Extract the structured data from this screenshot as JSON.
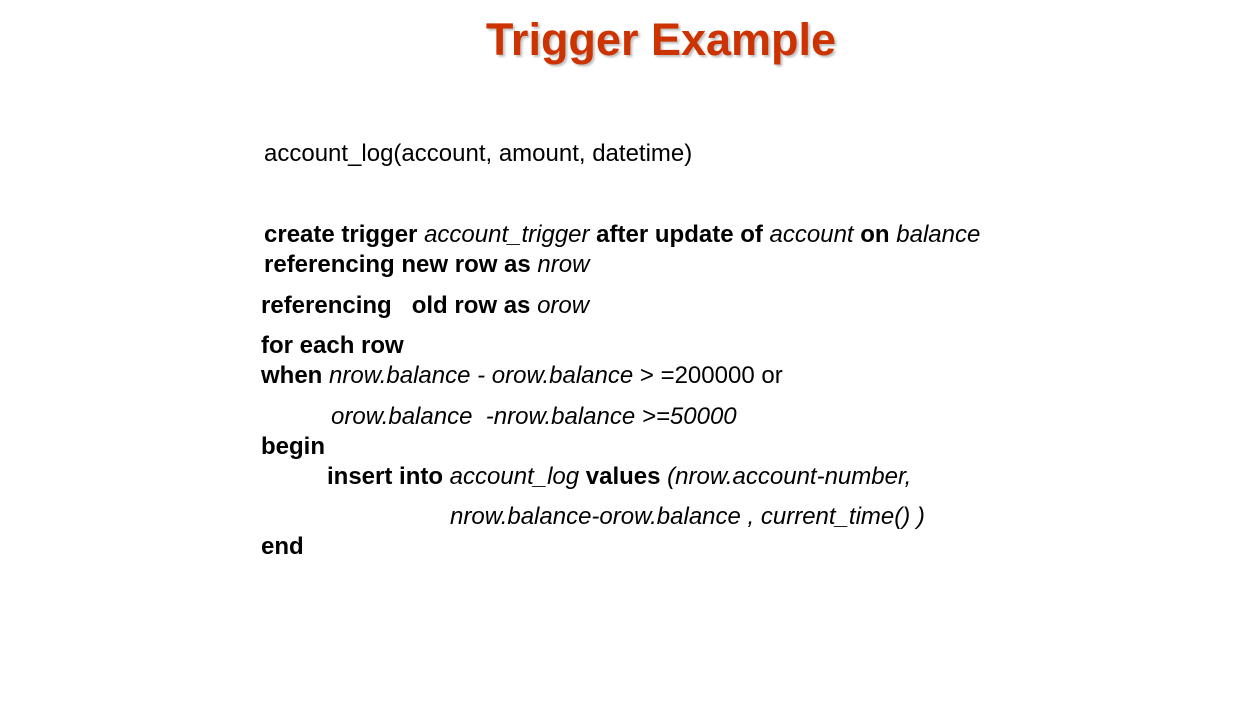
{
  "slide": {
    "title": "Trigger Example"
  },
  "code": {
    "schema": "account_log(account, amount, datetime)",
    "line1": {
      "kw1": "create trigger ",
      "trigger_name": "account_trigger",
      "kw2": " after update of ",
      "table": "account",
      "kw3": " on ",
      "column": "balance"
    },
    "line2": {
      "kw": "referencing new row as ",
      "alias": "nrow"
    },
    "line3": {
      "kw": "referencing   old row as ",
      "alias": "orow"
    },
    "line4": {
      "kw": "for each row"
    },
    "line5": {
      "kw": "when ",
      "expr": "nrow.balance - orow.balance",
      "rest": " > =200000 or"
    },
    "line6": {
      "expr": "orow.balance  -nrow.balance >=50000"
    },
    "line7": {
      "kw": "begin"
    },
    "line8": {
      "kw1": "insert into ",
      "table": "account_log",
      "kw2": " values ",
      "args": "(nrow.account-number,"
    },
    "line9": {
      "args": "nrow.balance-orow.balance , current_time() )"
    },
    "line10": {
      "kw": "end"
    }
  }
}
